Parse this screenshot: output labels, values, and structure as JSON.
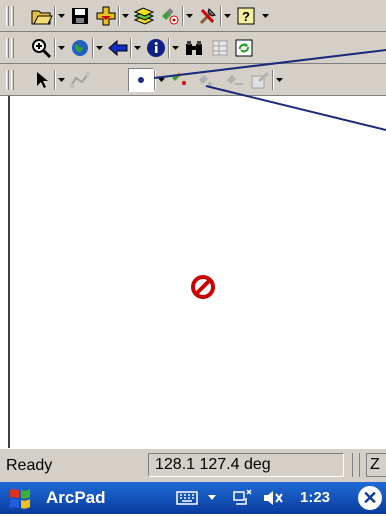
{
  "toolbars": {
    "row1": [
      "open-file",
      "save",
      "add-layer",
      "layer-manager",
      "gps-tool",
      "tools",
      "help"
    ],
    "row2": [
      "zoom-in",
      "full-extent",
      "back",
      "identify",
      "find",
      "table",
      "refresh"
    ],
    "row3": [
      "select",
      "edit-vertices",
      "point-tool",
      "gps-point",
      "add-gps-vertex",
      "stream",
      "properties"
    ]
  },
  "map": {
    "indicator": "no-gps-icon"
  },
  "status": {
    "text": "Ready",
    "coordinates": "128.1 127.4 deg",
    "extra": "Z"
  },
  "taskbar": {
    "app_title": "ArcPad",
    "time": "1:23",
    "ok_label": "✕"
  },
  "colors": {
    "toolbar_bg": "#d4d0c8",
    "taskbar_bg": "#0a3c9e",
    "no_symbol": "#cc0000",
    "callout_line": "#1a2a7a"
  }
}
